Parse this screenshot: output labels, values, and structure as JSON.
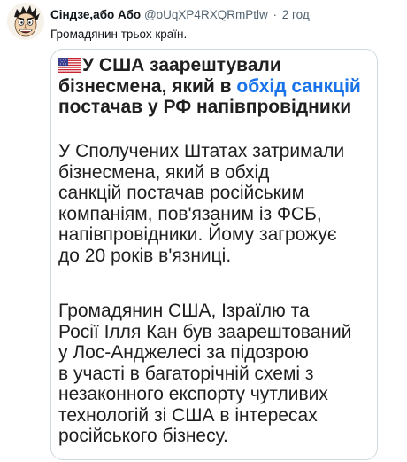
{
  "tweet": {
    "author_name": "Сіндзе,або Або",
    "handle": "@oUqXP4RXQRmPtlw",
    "separator": "·",
    "time": "2 год",
    "text": "Громадянин трьох країн.",
    "avatar_icon": "cartoon-face-avatar-icon"
  },
  "card": {
    "flag_icon": "us-flag-icon",
    "headline_part1": "У США заарештували бізнесмена, який в ",
    "headline_link": "обхід санкцій",
    "headline_part2": " постачав у РФ напівпровідники",
    "headline_link_color": "#1a73e8",
    "paragraph1_lines": [
      "У Сполучених Штатах затримали",
      "бізнесмена, який в обхід",
      "санкцій постачав російським",
      "компаніям, пов'язаним із ФСБ,",
      "напівпровідники. Йому загрожує",
      "до 20 років в'язниці."
    ],
    "paragraph2_lines": [
      "Громадянин США, Ізраїлю та",
      "Росії Ілля Кан був заарештований",
      "у Лос-Анджелесі за підозрою",
      "в участі в багаторічній схемі з",
      "незаконного експорту чутливих",
      "технологій зі США в інтересах",
      "російського бізнесу."
    ]
  },
  "colors": {
    "text": "#0f1419",
    "secondary": "#536471",
    "border": "#cfd9de"
  }
}
